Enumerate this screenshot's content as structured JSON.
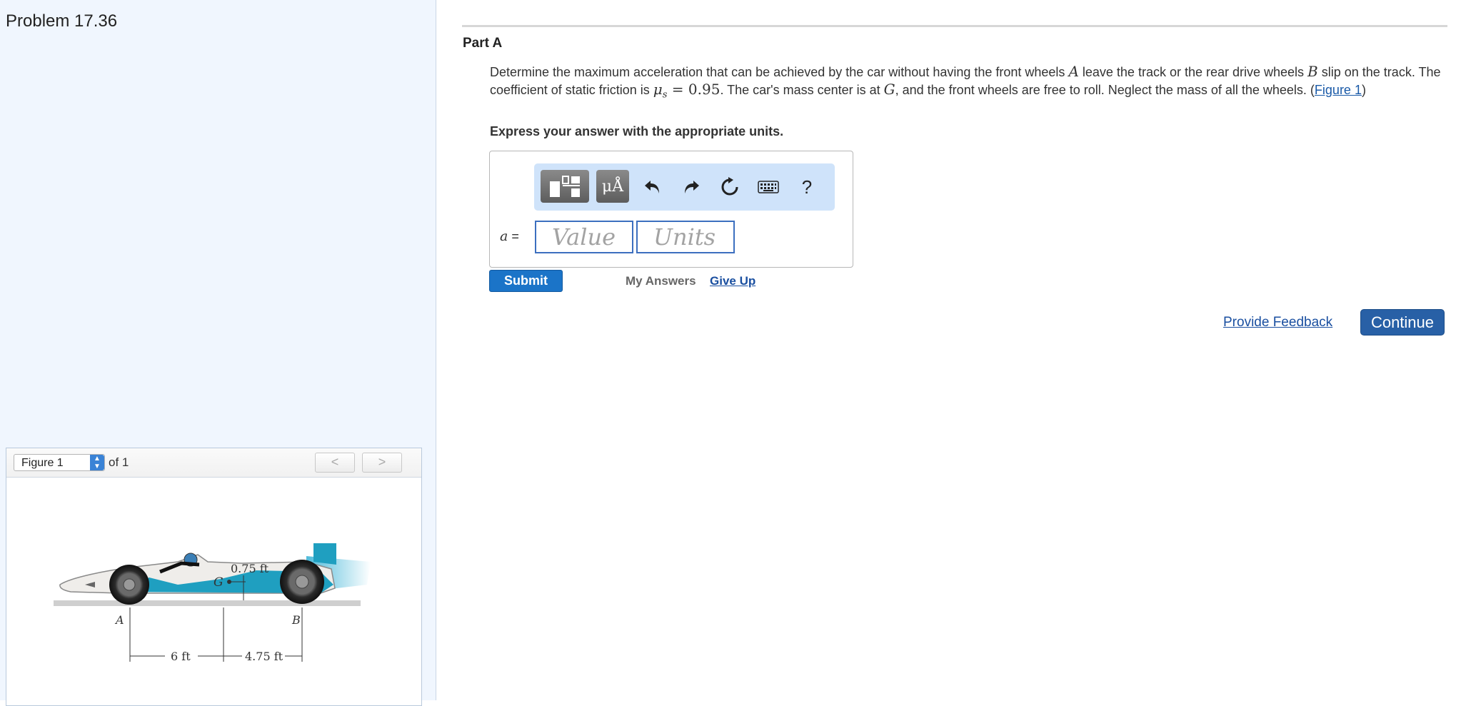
{
  "problem": {
    "title": "Problem 17.36"
  },
  "figure": {
    "selected": "Figure 1",
    "of_label": "of 1",
    "prev_label": "<",
    "next_label": ">",
    "labels": {
      "dim_height": "0.75 ft",
      "point_g": "G",
      "point_a": "A",
      "point_b": "B",
      "dim_front": "6 ft",
      "dim_rear": "4.75 ft"
    }
  },
  "part": {
    "title": "Part A",
    "question": {
      "t1": "Determine the maximum acceleration that can be achieved by the car without having the front wheels ",
      "m1": "A",
      "t2": " leave the track or the rear drive wheels ",
      "m2": "B",
      "t3": " slip on the track. The coefficient of static friction is ",
      "m3": "μ",
      "m3_sub": "s",
      "m4": " = 0.95",
      "t4": ". The car's mass center is at ",
      "m5": "G",
      "t5": ", and the front wheels are free to roll. Neglect the mass of all the wheels. (",
      "figure_link": "Figure 1",
      "t6": ")"
    },
    "instruction": "Express your answer with the appropriate units."
  },
  "answer": {
    "variable": "a",
    "equals": "=",
    "value_placeholder": "Value",
    "units_placeholder": "Units",
    "tools": {
      "units_label": "μÅ",
      "help_label": "?"
    }
  },
  "actions": {
    "submit": "Submit",
    "my_answers": "My Answers",
    "give_up": "Give Up",
    "feedback": "Provide Feedback",
    "continue": "Continue"
  },
  "colors": {
    "accent_blue": "#1b74c8",
    "continue_blue": "#2860a6",
    "link_blue": "#1a4fa0",
    "left_pane_bg": "#f0f6fe",
    "tool_tray_bg": "#cfe3fa",
    "car_teal": "#1f9fc0"
  },
  "icons": [
    "templates-icon",
    "undo-icon",
    "redo-icon",
    "reset-icon",
    "keyboard-icon",
    "help-icon",
    "chevron-up-down-icon",
    "chevron-left-icon",
    "chevron-right-icon"
  ]
}
